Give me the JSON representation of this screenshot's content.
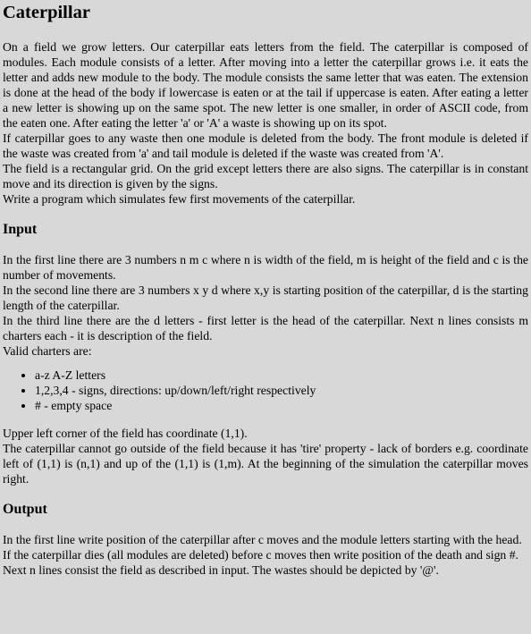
{
  "title": "Caterpillar",
  "description": [
    "On a field we grow letters. Our caterpillar eats letters from the field. The caterpillar is composed of modules. Each module consists of a letter. After moving into a letter the caterpillar grows i.e. it eats the letter and adds new module to the body. The module consists the same letter that was eaten. The extension is done at the head of the body if lowercase is eaten or at the tail if uppercase is eaten. After eating a letter a new letter is showing up on the same spot. The new letter is one smaller, in order of ASCII code, from the eaten one. After eating the letter 'a' or 'A' a waste is showing up on its spot.",
    "If caterpillar goes to any waste then one module is deleted from the body. The front module is deleted if the waste was created from 'a' and tail module is deleted if the waste was created from 'A'.",
    "The field is a rectangular grid. On the grid except letters there are also signs. The caterpillar is in constant move and its direction is given by the signs.",
    "Write a program which simulates few first movements of the caterpillar."
  ],
  "input": {
    "heading": "Input",
    "lines": [
      "In the first line there are 3 numbers n m c where n is width of the field, m is height of the field and c is the number of movements.",
      "In the second line there are 3 numbers x y d where x,y is starting position of the caterpillar, d is the starting length of the caterpillar.",
      "In the third line there are the d letters - first letter is the head of the caterpillar. Next n lines consists m charters each - it is description of the field.",
      "Valid charters are:"
    ],
    "valid_chars": [
      "a-z A-Z letters",
      "1,2,3,4 - signs, directions: up/down/left/right respectively",
      "# - empty space"
    ],
    "notes": [
      "Upper left corner of the field has coordinate (1,1).",
      "The caterpillar cannot go outside of the field because it has 'tire' property - lack of borders e.g. coordinate left of (1,1) is (n,1) and up of the (1,1) is (1,m). At the beginning of the simulation the caterpillar moves right."
    ]
  },
  "output": {
    "heading": "Output",
    "lines": [
      "In the first line write position of the caterpillar after c moves and the module letters starting with the head.",
      "If the caterpillar dies (all modules are deleted) before c moves then write position of the death and sign #.",
      "Next n lines consist the field as described in input. The wastes should be depicted by '@'."
    ]
  }
}
